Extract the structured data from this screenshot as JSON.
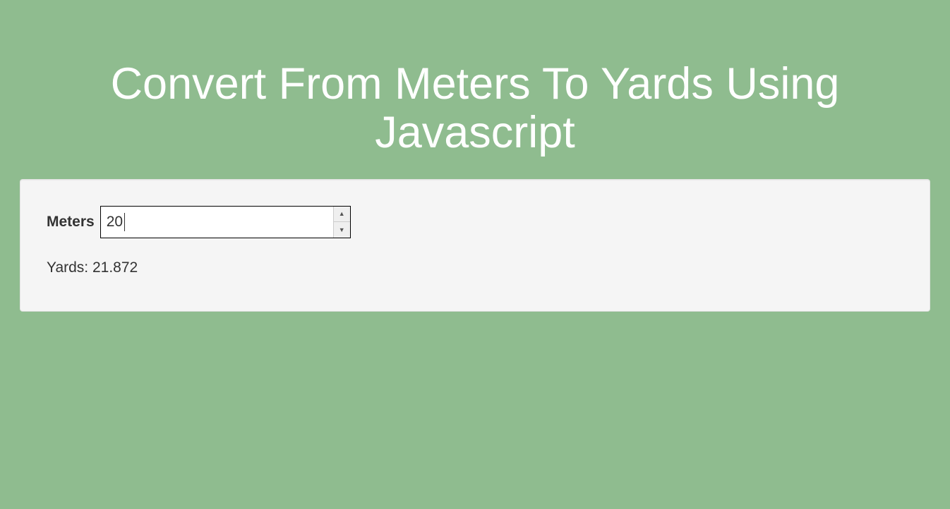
{
  "header": {
    "title": "Convert From Meters To Yards Using Javascript"
  },
  "form": {
    "meters_label": "Meters",
    "meters_value": "20"
  },
  "result": {
    "text": "Yards: 21.872"
  }
}
